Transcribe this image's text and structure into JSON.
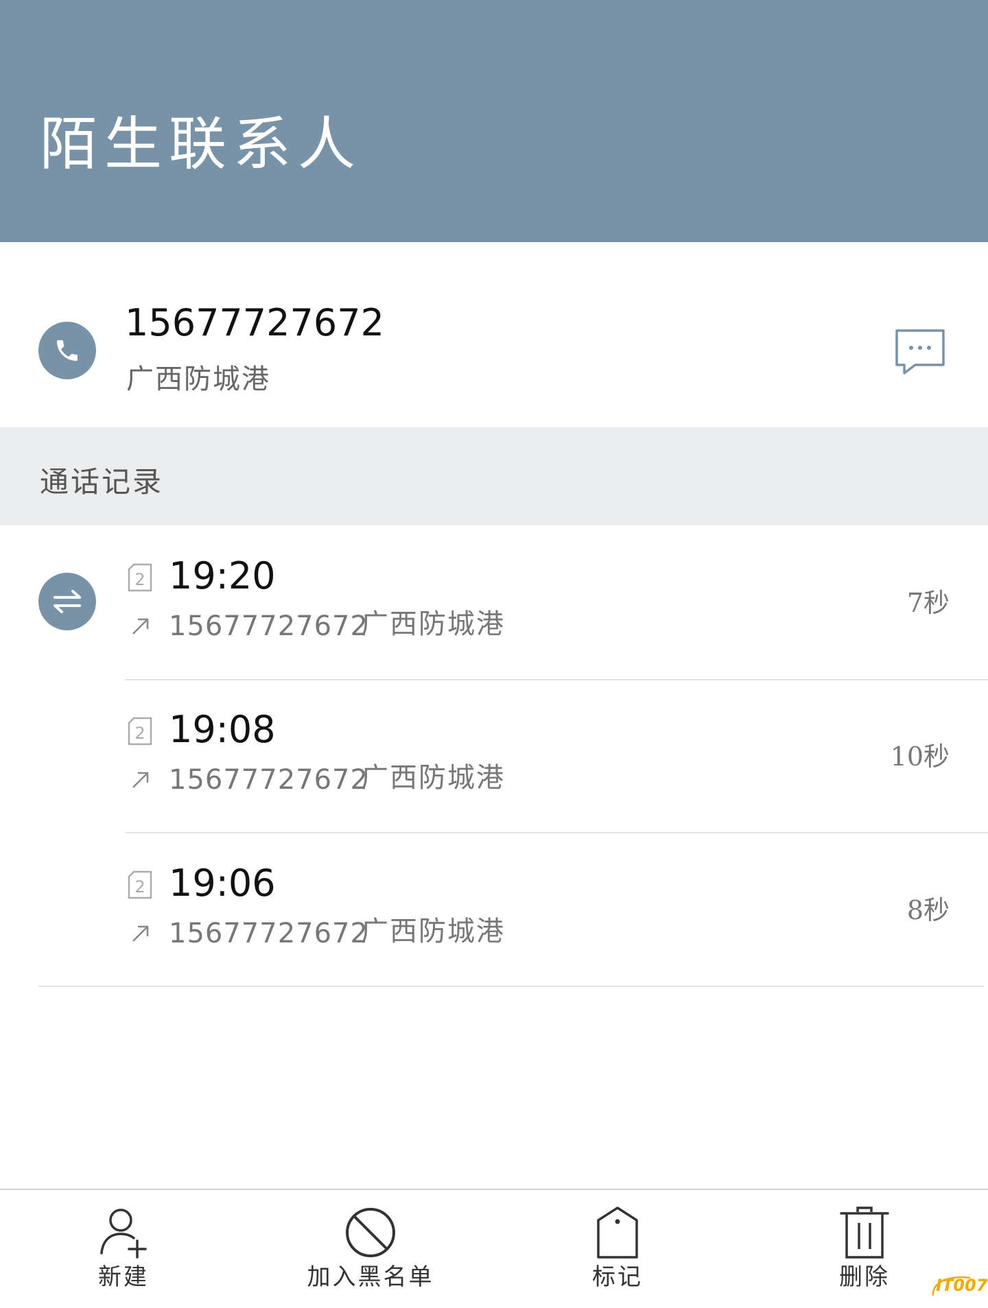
{
  "header": {
    "title": "陌生联系人",
    "background_color": "#7893a8"
  },
  "contact": {
    "phone_icon": "phone-icon",
    "number": "15677727672",
    "location": "广西防城港",
    "message_icon": "message-bubble-icon"
  },
  "call_log": {
    "title": "通话记录",
    "type_icon": "call-swap-icon",
    "entries": [
      {
        "sim": "2",
        "time": "19:20",
        "direction_icon": "outgoing-arrow-icon",
        "number": "15677727672",
        "location": "广西防城港",
        "duration": "7秒"
      },
      {
        "sim": "2",
        "time": "19:08",
        "direction_icon": "outgoing-arrow-icon",
        "number": "15677727672",
        "location": "广西防城港",
        "duration": "10秒"
      },
      {
        "sim": "2",
        "time": "19:06",
        "direction_icon": "outgoing-arrow-icon",
        "number": "15677727672",
        "location": "广西防城港",
        "duration": "8秒"
      }
    ]
  },
  "toolbar": {
    "new_label": "新建",
    "blacklist_label": "加入黑名单",
    "mark_label": "标记",
    "delete_label": "删除"
  },
  "watermark": "IT007"
}
